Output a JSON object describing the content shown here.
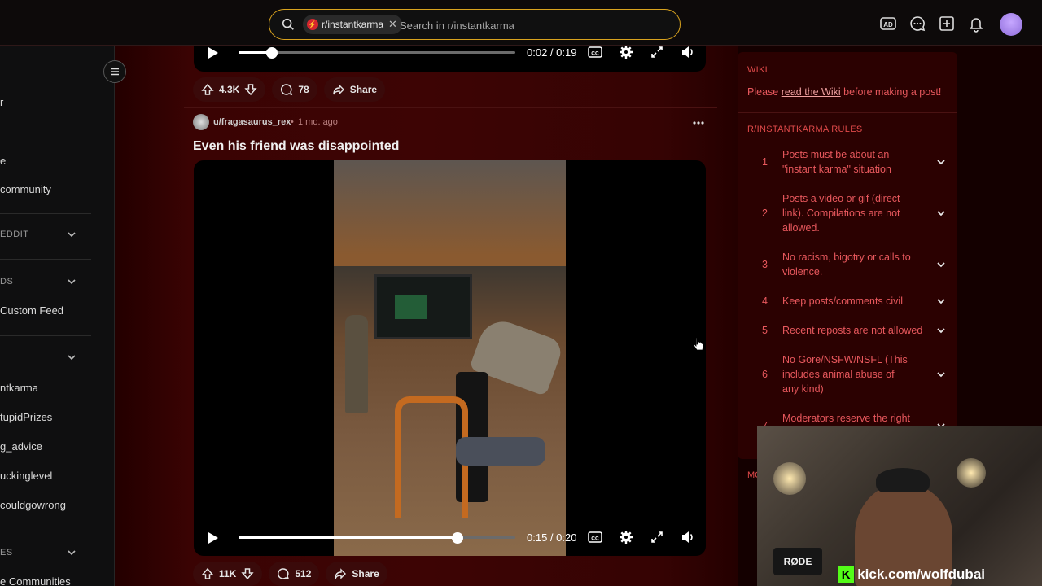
{
  "search": {
    "chip_label": "r/instantkarma",
    "placeholder": "Search in r/instantkarma"
  },
  "sidebar": {
    "items": [
      {
        "label": "r"
      },
      {
        "label": "e"
      },
      {
        "label": "community"
      },
      {
        "label": "EDDIT"
      },
      {
        "label": "DS"
      },
      {
        "label": "Custom Feed"
      },
      {
        "label": "ntkarma"
      },
      {
        "label": "tupidPrizes"
      },
      {
        "label": "g_advice"
      },
      {
        "label": "uckinglevel"
      },
      {
        "label": "couldgowrong"
      },
      {
        "label": "ES"
      },
      {
        "label": "e Communities"
      }
    ]
  },
  "post1": {
    "time": "0:02 / 0:19",
    "progress": 0.12,
    "votes": "4.3K",
    "comments": "78",
    "share": "Share"
  },
  "post2": {
    "author": "u/fragasaurus_rex",
    "age": "1 mo. ago",
    "title": "Even his friend was disappointed",
    "time": "0:15 / 0:20",
    "progress": 0.79,
    "votes": "11K",
    "comments": "512",
    "share": "Share"
  },
  "right": {
    "wiki_head": "WIKI",
    "wiki_pre": "Please ",
    "wiki_link": "read the Wiki",
    "wiki_post": " before making a post!",
    "rules_head": "R/INSTANTKARMA RULES",
    "rules": [
      {
        "n": "1",
        "text": "Posts must be about an \"instant karma\" situation"
      },
      {
        "n": "2",
        "text": "Posts a video or gif (direct link). Compilations are not allowed."
      },
      {
        "n": "3",
        "text": "No racism, bigotry or calls to violence."
      },
      {
        "n": "4",
        "text": "Keep posts/comments civil"
      },
      {
        "n": "5",
        "text": "Recent reposts are not allowed"
      },
      {
        "n": "6",
        "text": "No Gore/NSFW/NSFL (This includes animal abuse of any kind)"
      },
      {
        "n": "7",
        "text": "Moderators reserve the right"
      }
    ],
    "mod_head_partial": "MC"
  },
  "webcam": {
    "kick_text": "kick.com/wolfdubai",
    "mic_brand": "RØDE"
  },
  "colors": {
    "accent": "#d9a31e",
    "brand": "#d6262f",
    "rules_text": "#e8585d",
    "feed_bg": "#3d0404"
  }
}
